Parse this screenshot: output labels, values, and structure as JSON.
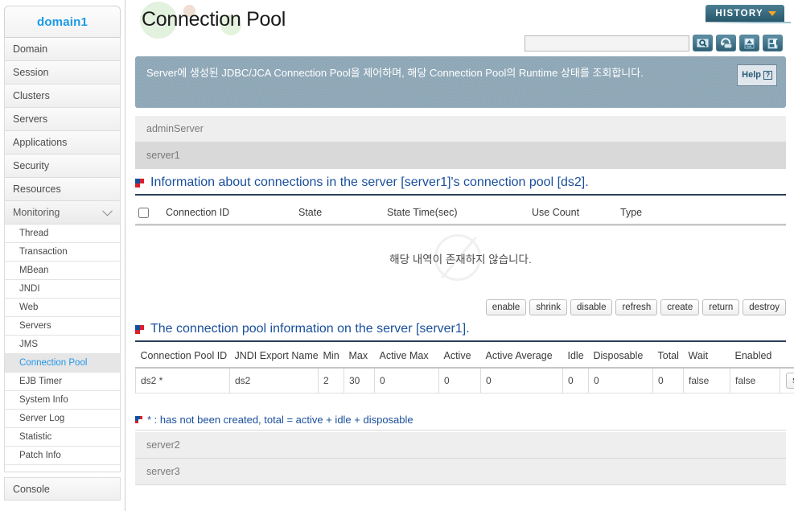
{
  "sidebar": {
    "domain_label": "domain1",
    "items": [
      {
        "label": "Domain"
      },
      {
        "label": "Session"
      },
      {
        "label": "Clusters"
      },
      {
        "label": "Servers"
      },
      {
        "label": "Applications"
      },
      {
        "label": "Security"
      },
      {
        "label": "Resources"
      },
      {
        "label": "Monitoring",
        "expanded": true
      }
    ],
    "sub_items": [
      {
        "label": "Thread"
      },
      {
        "label": "Transaction"
      },
      {
        "label": "MBean"
      },
      {
        "label": "JNDI"
      },
      {
        "label": "Web"
      },
      {
        "label": "Servers"
      },
      {
        "label": "JMS"
      },
      {
        "label": "Connection Pool",
        "active": true
      },
      {
        "label": "EJB Timer"
      },
      {
        "label": "System Info"
      },
      {
        "label": "Server Log"
      },
      {
        "label": "Statistic"
      },
      {
        "label": "Patch Info"
      }
    ],
    "console_label": "Console"
  },
  "header": {
    "title": "Connection Pool",
    "history_label": "HISTORY",
    "search_value": "",
    "search_placeholder": "",
    "icons": [
      {
        "name": "search-icon"
      },
      {
        "name": "refresh-icon"
      },
      {
        "name": "xml-export-icon"
      },
      {
        "name": "save-export-icon"
      }
    ]
  },
  "banner": {
    "text": "Server에 생성된 JDBC/JCA Connection Pool을 제어하며, 해당 Connection Pool의 Runtime 상태를 조회합니다.",
    "help_label": "Help",
    "help_mark": "?"
  },
  "server_rows_top": [
    {
      "label": "adminServer"
    },
    {
      "label": "server1"
    }
  ],
  "server_rows_bottom": [
    {
      "label": "server2"
    },
    {
      "label": "server3"
    }
  ],
  "connections_section": {
    "title": "Information about connections in the server [server1]'s connection pool [ds2].",
    "columns": [
      "",
      "Connection ID",
      "State",
      "State Time(sec)",
      "Use Count",
      "Type"
    ],
    "rows": [],
    "empty_message": "해당 내역이 존재하지 않습니다."
  },
  "action_buttons": [
    {
      "label": "enable"
    },
    {
      "label": "shrink"
    },
    {
      "label": "disable"
    },
    {
      "label": "refresh"
    },
    {
      "label": "create"
    },
    {
      "label": "return"
    },
    {
      "label": "destroy"
    }
  ],
  "pool_section": {
    "title": "The connection pool information on the server [server1].",
    "columns": [
      "Connection Pool ID",
      "JNDI Export Name",
      "Min",
      "Max",
      "Active Max",
      "Active",
      "Active Average",
      "Idle",
      "Disposable",
      "Total",
      "Wait",
      "Enabled",
      ""
    ],
    "rows": [
      {
        "connection_pool_id": "ds2 *",
        "jndi_export_name": "ds2",
        "min": "2",
        "max": "30",
        "active_max": "0",
        "active": "0",
        "active_average": "0",
        "idle": "0",
        "disposable": "0",
        "total": "0",
        "wait": "false",
        "enabled": "false",
        "stmt_label": "stmt"
      }
    ],
    "footnote": "* : has not been created, total = active + idle + disposable"
  },
  "colors": {
    "accent_blue": "#1a4f9c",
    "domain_blue": "#1a9ae8",
    "banner_bg": "#8aa4b4",
    "history_bg": "#27576b",
    "history_arrow": "#f5a623",
    "marker_red": "#d81f2a"
  }
}
